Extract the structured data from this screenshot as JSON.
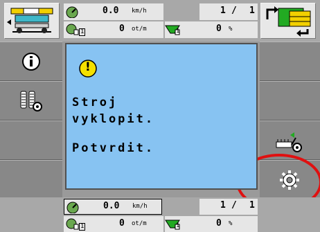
{
  "top_status": {
    "speed_value": "0.0",
    "speed_unit": "km/h",
    "rpm_value": "0",
    "rpm_unit": "ot/m",
    "page_current": "1",
    "page_sep": "/",
    "page_total": "1",
    "percent_value": "0",
    "percent_unit": "%",
    "index_1": "1",
    "index_2": "1"
  },
  "bottom_status": {
    "speed_value": "0.0",
    "speed_unit": "km/h",
    "rpm_value": "0",
    "rpm_unit": "ot/m",
    "page_current": "1",
    "page_sep": "/",
    "page_total": "1",
    "percent_value": "0",
    "percent_unit": "%",
    "index_1": "1",
    "index_2": "1"
  },
  "dialog": {
    "warning_symbol": "!",
    "line1": "Stroj",
    "line2": "vyklopit.",
    "line3": "Potvrdit."
  },
  "left_softkeys": [
    "info-icon",
    "tyre-settings-icon"
  ],
  "right_softkeys": [
    "machine-unfold-icon",
    "settings-gear-icon"
  ],
  "colors": {
    "dialog_bg": "#87c3f2",
    "warning_yellow": "#f5e000",
    "highlight_circle": "#e01010",
    "green_indicator": "#22aa22"
  }
}
